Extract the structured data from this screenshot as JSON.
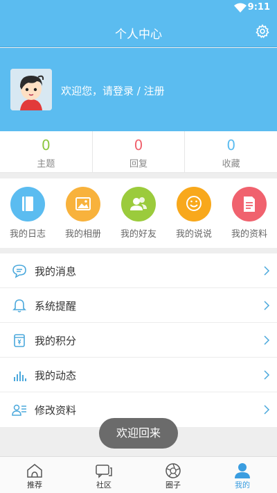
{
  "status_bar": {
    "time": "9:11"
  },
  "header": {
    "title": "个人中心"
  },
  "profile": {
    "welcome_text": "欢迎您，请登录 / 注册"
  },
  "stats": [
    {
      "value": "0",
      "label": "主题",
      "color": "#8cc63f"
    },
    {
      "value": "0",
      "label": "回复",
      "color": "#f0626e"
    },
    {
      "value": "0",
      "label": "收藏",
      "color": "#5bbcf0"
    }
  ],
  "quick_actions": [
    {
      "label": "我的日志",
      "icon": "book-icon",
      "color": "#5bbcf0"
    },
    {
      "label": "我的相册",
      "icon": "photo-icon",
      "color": "#f8b23c"
    },
    {
      "label": "我的好友",
      "icon": "friends-icon",
      "color": "#9bcb3c"
    },
    {
      "label": "我的说说",
      "icon": "chat-smile-icon",
      "color": "#f8a81c"
    },
    {
      "label": "我的资料",
      "icon": "document-icon",
      "color": "#f0626e"
    }
  ],
  "menu": [
    {
      "label": "我的消息",
      "icon": "message-icon"
    },
    {
      "label": "系统提醒",
      "icon": "bell-icon"
    },
    {
      "label": "我的积分",
      "icon": "points-icon"
    },
    {
      "label": "我的动态",
      "icon": "activity-icon"
    },
    {
      "label": "修改资料",
      "icon": "edit-profile-icon"
    }
  ],
  "toast": {
    "text": "欢迎回来"
  },
  "tabbar": [
    {
      "label": "推荐",
      "icon": "home-icon",
      "active": false
    },
    {
      "label": "社区",
      "icon": "community-icon",
      "active": false
    },
    {
      "label": "圈子",
      "icon": "circle-icon",
      "active": false
    },
    {
      "label": "我的",
      "icon": "user-icon",
      "active": true
    }
  ],
  "colors": {
    "primary": "#5bbcf0",
    "tab_active": "#3a9de0"
  }
}
